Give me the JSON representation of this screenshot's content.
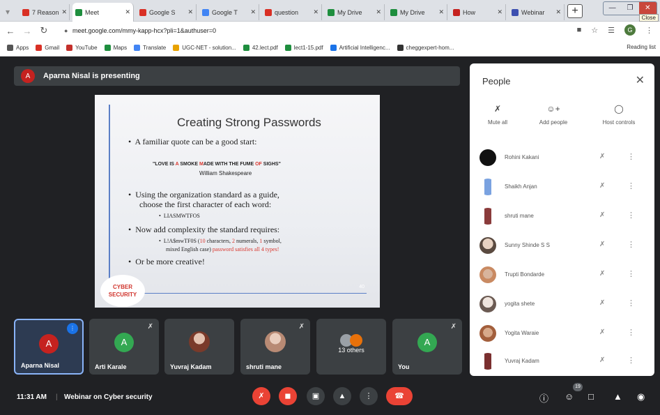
{
  "tabs": [
    {
      "title": "7 Reason",
      "color": "#d93025",
      "active": false
    },
    {
      "title": "Meet",
      "color": "#1e8e3e",
      "active": true
    },
    {
      "title": "Google S",
      "color": "#d93025",
      "active": false
    },
    {
      "title": "Google T",
      "color": "#4285f4",
      "active": false
    },
    {
      "title": "question",
      "color": "#d93025",
      "active": false
    },
    {
      "title": "My Drive",
      "color": "#1e8e3e",
      "active": false
    },
    {
      "title": "My Drive",
      "color": "#1e8e3e",
      "active": false
    },
    {
      "title": "How",
      "color": "#c5221f",
      "active": false
    },
    {
      "title": "Webinar",
      "color": "#3c4fb0",
      "active": false
    }
  ],
  "window": {
    "tooltip": "Close"
  },
  "address": {
    "url": "meet.google.com/mmy-kapp-hcx?pli=1&authuser=0"
  },
  "bookmarks": [
    {
      "label": "Apps",
      "color": "#555"
    },
    {
      "label": "Gmail",
      "color": "#d93025"
    },
    {
      "label": "YouTube",
      "color": "#c4302b"
    },
    {
      "label": "Maps",
      "color": "#1e8e3e"
    },
    {
      "label": "Translate",
      "color": "#4285f4"
    },
    {
      "label": "UGC-NET - solution...",
      "color": "#e8a200"
    },
    {
      "label": "42.lect.pdf",
      "color": "#1e8e3e"
    },
    {
      "label": "lect1-15.pdf",
      "color": "#1e8e3e"
    },
    {
      "label": "Artificial Intelligenc...",
      "color": "#1a73e8"
    },
    {
      "label": "cheggexpert-hom...",
      "color": "#333"
    }
  ],
  "bookmarks_right": "Reading list",
  "meeting": {
    "presenter_banner": "Aparna Nisal is presenting",
    "presenter_initial": "A",
    "time": "11:31 AM",
    "title": "Webinar on Cyber security",
    "participant_count": "19"
  },
  "slide": {
    "title": "Creating Strong Passwords",
    "bullet1": "A familiar quote can be a good start:",
    "quote_parts": [
      "\"LOVE IS ",
      "A",
      " SMOKE ",
      "M",
      "ADE WITH THE FUME ",
      "OF",
      " SIGHS\""
    ],
    "author": "William Shakespeare",
    "bullet2_line1": "Using the organization standard as a guide,",
    "bullet2_line2": "choose the first character of each word:",
    "sub_bullet1": "LIASMWTFOS",
    "bullet3": "Now add complexity the standard requires:",
    "sub2_part1": "L!A$mwTF0S (",
    "sub2_part2": "10",
    "sub2_part3": " characters, ",
    "sub2_part4": "2",
    "sub2_part5": " numerals, ",
    "sub2_part6": "1",
    "sub2_part7": " symbol,",
    "sub2_line2a": "mixed English case) ",
    "sub2_line2b": "password satisfies all 4 types!",
    "bullet4": "Or be more creative!",
    "badge": "CYBER SECURITY",
    "page_number": "40"
  },
  "tiles": [
    {
      "name": "Aparna Nisal",
      "kind": "initial",
      "initial": "A",
      "color": "#c5221f",
      "selected": true
    },
    {
      "name": "Arti Karale",
      "kind": "initial",
      "initial": "A",
      "color": "#33a852",
      "selected": false
    },
    {
      "name": "Yuvraj Kadam",
      "kind": "photo",
      "selected": false
    },
    {
      "name": "shruti mane",
      "kind": "photo",
      "selected": false
    },
    {
      "name": "13 others",
      "kind": "others",
      "selected": false
    },
    {
      "name": "You",
      "kind": "initial",
      "initial": "A",
      "color": "#33a852",
      "selected": false
    }
  ],
  "panel": {
    "title": "People",
    "actions": {
      "mute": "Mute all",
      "add": "Add people",
      "host": "Host controls"
    },
    "participants": [
      "Rohini Kakani",
      "Shaikh Anjan",
      "shruti mane",
      "Sunny Shinde S S",
      "Trupti Bondarde",
      "yogita shete",
      "Yogita Waraie",
      "Yuvraj Kadam"
    ]
  }
}
